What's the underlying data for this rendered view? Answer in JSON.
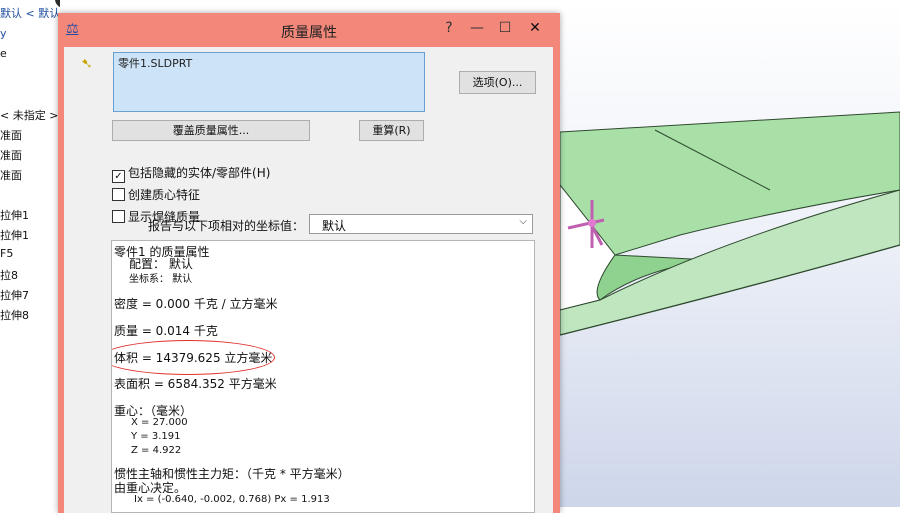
{
  "tree": {
    "header": "默认 < 默认 > 显示状态",
    "items": [
      "y",
      "e",
      "",
      "< 未指定 >",
      "准面",
      "准面",
      "准面",
      "拉伸1",
      "拉伸1",
      "F5",
      "拉8",
      "拉伸7",
      "拉伸8"
    ]
  },
  "dialog": {
    "title": "质量属性",
    "window_buttons": {
      "help": "?",
      "minimize": "—",
      "maximize": "☐",
      "close": "✕"
    },
    "part_name": "零件1.SLDPRT",
    "options_button": "选项(O)...",
    "override_button": "覆盖质量属性...",
    "recalculate_button": "重算(R)",
    "checkboxes": [
      {
        "label": "包括隐藏的实体/零部件(H)",
        "checked": true
      },
      {
        "label": "创建质心特征",
        "checked": false
      },
      {
        "label": "显示焊缝质量",
        "checked": false
      }
    ],
    "coord_label": "报告与以下项相对的坐标值：",
    "coord_value": "默认",
    "results": {
      "heading": "零件1 的质量属性",
      "config": "配置： 默认",
      "coord_sys": "坐标系：  默认",
      "density": "密度 = 0.000 千克 / 立方毫米",
      "mass": "质量 = 0.014 千克",
      "volume": "体积 = 14379.625 立方毫米",
      "surface_area": "表面积 = 6584.352  平方毫米",
      "com_heading": "重心：（毫米）",
      "com_x": "X = 27.000",
      "com_y": "Y = 3.191",
      "com_z": "Z = 4.922",
      "inertia_heading": "惯性主轴和惯性主力矩：（千克 * 平方毫米）",
      "inertia_sub": "由重心决定。",
      "ix": "Ix = (-0.640, -0.002, 0.768)     Px = 1.913"
    }
  },
  "colors": {
    "title_bar": "#f2877a",
    "listbox_selected": "#cde3f7",
    "highlight_circle": "#e0302a",
    "model_face": "#a8e0a8"
  }
}
